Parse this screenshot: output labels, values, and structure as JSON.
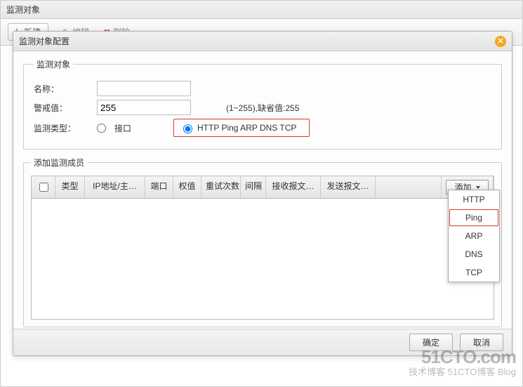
{
  "window": {
    "title": "监测对象"
  },
  "toolbar": {
    "new_btn": "新建",
    "edit_link": "编辑",
    "delete_link": "删除"
  },
  "modal": {
    "title": "监测对象配置",
    "group1": {
      "legend": "监测对象",
      "name_label": "名称：",
      "name_value": "",
      "threshold_label": "警戒值：",
      "threshold_value": "255",
      "threshold_hint": "(1~255),缺省值:255",
      "type_label": "监测类型：",
      "radio_iface": "接口",
      "radio_protocols": "HTTP Ping ARP DNS TCP"
    },
    "group2": {
      "legend": "添加监测成员",
      "cols": {
        "type": "类型",
        "ip": "IP地址/主…",
        "port": "端口",
        "weight": "权值",
        "retry": "重试次数",
        "interval": "间隔",
        "recv": "接收报文…",
        "send": "发送报文…"
      },
      "add_btn": "添加"
    },
    "dropdown": [
      "HTTP",
      "Ping",
      "ARP",
      "DNS",
      "TCP"
    ],
    "dropdown_highlight": "Ping",
    "footer": {
      "ok": "确定",
      "cancel": "取消"
    }
  },
  "watermark": {
    "big": "51CTO.com",
    "small": "技术博客   51CTO博客 Blog"
  }
}
